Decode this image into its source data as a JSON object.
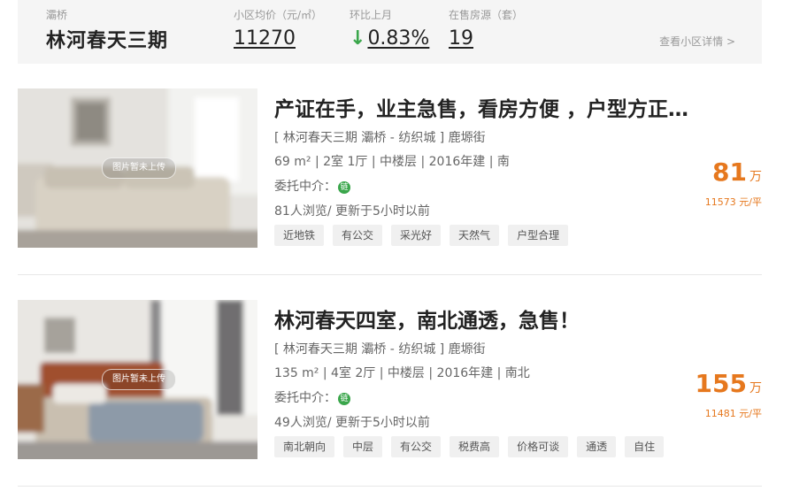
{
  "summary": {
    "district": "灞桥",
    "name": "林河春天三期",
    "avg_price_label": "小区均价（元/㎡）",
    "avg_price": "11270",
    "mom_label": "环比上月",
    "mom_arrow": "↓",
    "mom_value": "0.83%",
    "on_sale_label": "在售房源（套）",
    "on_sale_count": "19",
    "detail_link": "查看小区详情 >"
  },
  "listings": [
    {
      "image_badge": "图片暂未上传",
      "title": "产证在手，业主急售，看房方便 ，户型方正，南北通透",
      "location": "[ 林河春天三期 灞桥 - 纺织城 ] 鹿塬街",
      "specs": "69 m² | 2室 1厅 | 中楼层 | 2016年建 | 南",
      "agent_label": "委托中介：",
      "agent_icon": "链",
      "activity": "81人浏览/ 更新于5小时以前",
      "tags": [
        "近地铁",
        "有公交",
        "采光好",
        "天然气",
        "户型合理"
      ],
      "price": "81",
      "price_unit": "万",
      "unit_price": "11573 元/平"
    },
    {
      "image_badge": "图片暂未上传",
      "title": "林河春天四室，南北通透，急售！",
      "location": "[ 林河春天三期 灞桥 - 纺织城 ] 鹿塬街",
      "specs": "135 m² | 4室 2厅 | 中楼层 | 2016年建 | 南北",
      "agent_label": "委托中介：",
      "agent_icon": "链",
      "activity": "49人浏览/ 更新于5小时以前",
      "tags": [
        "南北朝向",
        "中层",
        "有公交",
        "税费高",
        "价格可谈",
        "通透",
        "自住"
      ],
      "price": "155",
      "price_unit": "万",
      "unit_price": "11481 元/平"
    }
  ]
}
